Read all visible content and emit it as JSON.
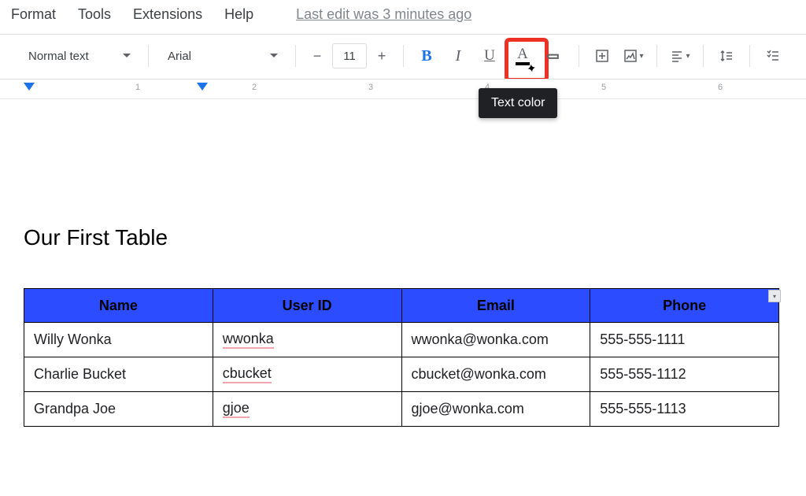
{
  "menu": {
    "items": [
      "Format",
      "Tools",
      "Extensions",
      "Help"
    ],
    "last_edit": "Last edit was 3 minutes ago"
  },
  "toolbar": {
    "style": "Normal text",
    "font": "Arial",
    "fontsize": "11",
    "bold": "B",
    "italic": "I",
    "underline": "U",
    "textcolor": "A",
    "tooltip": "Text color"
  },
  "ruler": {
    "numbers": [
      "1",
      "2",
      "3",
      "4",
      "5",
      "6"
    ]
  },
  "doc": {
    "title": "Our First Table",
    "headers": [
      "Name",
      "User ID",
      "Email",
      "Phone"
    ],
    "rows": [
      {
        "name": "Willy Wonka",
        "userid": "wwonka",
        "email": "wwonka@wonka.com",
        "phone": "555-555-1111"
      },
      {
        "name": "Charlie Bucket",
        "userid": "cbucket",
        "email": "cbucket@wonka.com",
        "phone": "555-555-1112"
      },
      {
        "name": "Grandpa Joe",
        "userid": "gjoe",
        "email": "gjoe@wonka.com",
        "phone": "555-555-1113"
      }
    ]
  }
}
